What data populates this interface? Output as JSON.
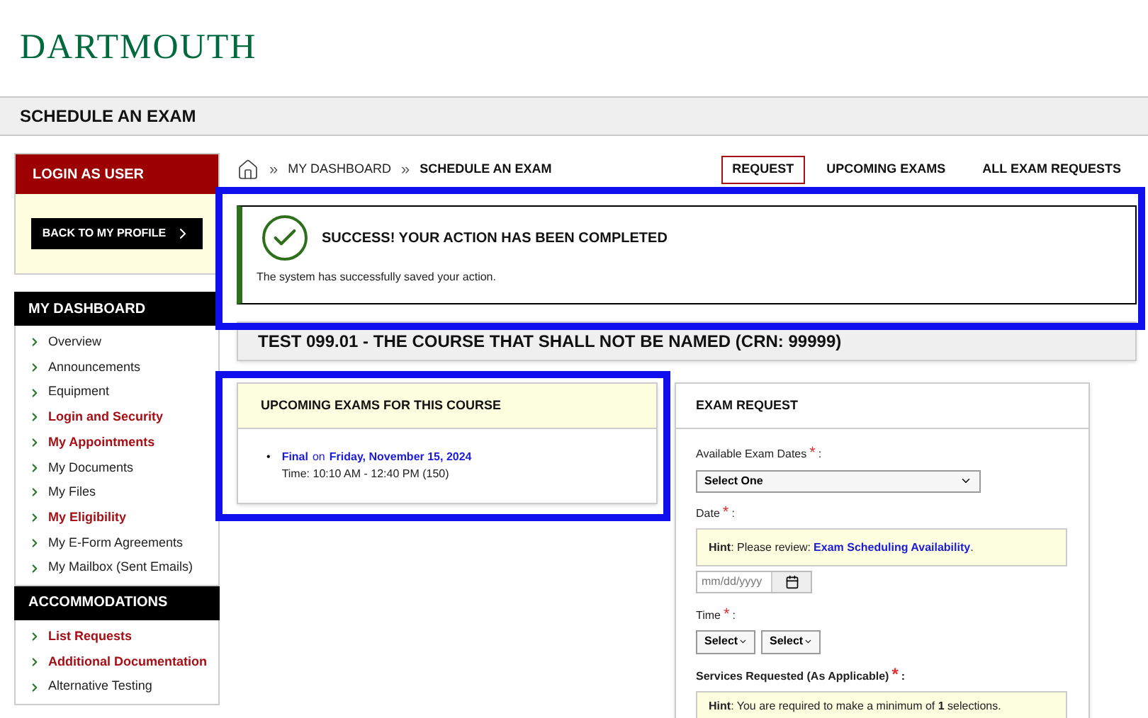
{
  "logo": "DARTMOUTH",
  "page_title": "SCHEDULE AN EXAM",
  "sidebar": {
    "login_panel": {
      "title": "LOGIN AS USER",
      "button": "BACK TO MY PROFILE"
    },
    "sections": [
      {
        "title": "MY DASHBOARD",
        "items": [
          {
            "label": "Overview",
            "highlighted": false
          },
          {
            "label": "Announcements",
            "highlighted": false
          },
          {
            "label": "Equipment",
            "highlighted": false
          },
          {
            "label": "Login and Security",
            "highlighted": true
          },
          {
            "label": "My Appointments",
            "highlighted": true
          },
          {
            "label": "My Documents",
            "highlighted": false
          },
          {
            "label": "My Files",
            "highlighted": false
          },
          {
            "label": "My Eligibility",
            "highlighted": true
          },
          {
            "label": "My E-Form Agreements",
            "highlighted": false
          },
          {
            "label": "My Mailbox (Sent Emails)",
            "highlighted": false
          }
        ]
      },
      {
        "title": "ACCOMMODATIONS",
        "items": [
          {
            "label": "List Requests",
            "highlighted": true
          },
          {
            "label": "Additional Documentation",
            "highlighted": true
          },
          {
            "label": "Alternative Testing",
            "highlighted": false
          }
        ]
      }
    ]
  },
  "breadcrumb_separator": "»",
  "breadcrumb": [
    {
      "label": "MY DASHBOARD",
      "current": false
    },
    {
      "label": "SCHEDULE AN EXAM",
      "current": true
    }
  ],
  "tabs": [
    {
      "label": "REQUEST",
      "selected": true
    },
    {
      "label": "UPCOMING EXAMS",
      "selected": false
    },
    {
      "label": "ALL EXAM REQUESTS",
      "selected": false
    }
  ],
  "alert": {
    "title": "SUCCESS! YOUR ACTION HAS BEEN COMPLETED",
    "message": "The system has successfully saved your action."
  },
  "course_title": "TEST 099.01 - THE COURSE THAT SHALL NOT BE NAMED (CRN: 99999)",
  "upcoming": {
    "title": "UPCOMING EXAMS FOR THIS COURSE",
    "exams": [
      {
        "bullet": "•",
        "type": "Final",
        "joiner": "on",
        "date": "Friday, November 15, 2024",
        "time": "Time: 10:10 AM - 12:40 PM (150)"
      }
    ]
  },
  "exam_request": {
    "title": "EXAM REQUEST",
    "dates_label": "Available Exam Dates",
    "dates_value": "Select One",
    "date_label": "Date",
    "date_hint": "**Hint**: Please review: ",
    "date_hint_link": "Exam Scheduling Availability",
    "date_hint_end": ".",
    "date_placeholder": "mm/dd/yyyy",
    "time_label": "Time",
    "time_selects": [
      "Select",
      "Select"
    ],
    "services_label": "Services Requested (As Applicable)",
    "services_hint": "**Hint**: You are required to make a minimum of **1** selections.",
    "required_mark": "*",
    "label_suffix": ":"
  }
}
